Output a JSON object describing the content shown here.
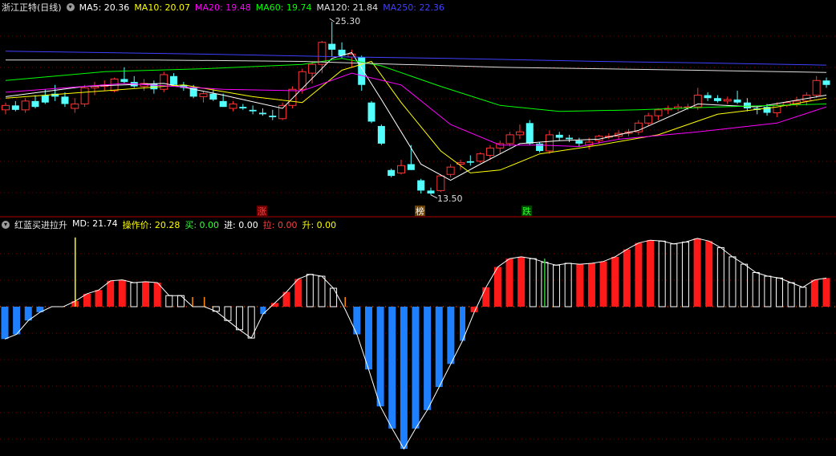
{
  "top_panel": {
    "title": "浙江正特(日线)",
    "ma_legend": [
      {
        "label": "MA5: 20.36",
        "color": "#ffffff"
      },
      {
        "label": "MA10: 20.07",
        "color": "#ffff00"
      },
      {
        "label": "MA20: 19.48",
        "color": "#ff00ff"
      },
      {
        "label": "MA60: 19.74",
        "color": "#00ff00"
      },
      {
        "label": "MA120: 21.84",
        "color": "#e0e0e0"
      },
      {
        "label": "MA250: 22.36",
        "color": "#4040ff"
      }
    ],
    "high_label": "25.30",
    "low_label": "13.50",
    "markers": [
      {
        "text": "涨",
        "color": "#ff4040",
        "bg": "#6a0000"
      },
      {
        "text": "榜",
        "color": "#ffffff",
        "bg": "#6a4000"
      },
      {
        "text": "跌",
        "color": "#33ff33",
        "bg": "#004400"
      }
    ]
  },
  "bottom_panel": {
    "title": "红蓝买进拉升",
    "legend": [
      {
        "label": "MD: 21.74",
        "color": "#ffffff"
      },
      {
        "label": "操作价: 20.28",
        "color": "#ffff00"
      },
      {
        "label": "买: 0.00",
        "color": "#33ff33"
      },
      {
        "label": "进: 0.00",
        "color": "#ffffff"
      },
      {
        "label": "拉: 0.00",
        "color": "#ff4040"
      },
      {
        "label": "升: 0.00",
        "color": "#ffff00"
      }
    ]
  },
  "chart_data": [
    {
      "type": "candlestick",
      "title": "浙江正特(日线)",
      "candles_ohlc": [
        [
          19.3,
          19.8,
          19.0,
          19.6
        ],
        [
          19.6,
          19.9,
          19.2,
          19.3
        ],
        [
          19.3,
          20.1,
          19.1,
          19.9
        ],
        [
          19.9,
          20.3,
          19.4,
          19.5
        ],
        [
          20.3,
          20.7,
          19.7,
          19.8
        ],
        [
          20.4,
          21.0,
          19.9,
          20.2
        ],
        [
          20.2,
          20.5,
          19.5,
          19.7
        ],
        [
          19.4,
          20.1,
          19.1,
          19.7
        ],
        [
          19.7,
          21.0,
          19.5,
          20.8
        ],
        [
          20.8,
          21.2,
          20.3,
          20.9
        ],
        [
          20.9,
          21.3,
          20.6,
          21.0
        ],
        [
          20.6,
          21.5,
          20.5,
          21.4
        ],
        [
          21.4,
          22.2,
          21.1,
          21.2
        ],
        [
          21.2,
          21.6,
          20.8,
          20.9
        ],
        [
          20.9,
          21.4,
          20.6,
          21.1
        ],
        [
          21.1,
          21.3,
          20.4,
          20.7
        ],
        [
          20.7,
          21.9,
          20.5,
          21.7
        ],
        [
          21.6,
          21.8,
          20.9,
          21.0
        ],
        [
          21.0,
          21.2,
          20.6,
          20.8
        ],
        [
          20.8,
          21.0,
          20.1,
          20.2
        ],
        [
          20.2,
          20.6,
          19.8,
          20.4
        ],
        [
          20.4,
          20.7,
          19.9,
          20.0
        ],
        [
          19.9,
          20.4,
          19.5,
          19.5
        ],
        [
          19.4,
          19.9,
          19.2,
          19.7
        ],
        [
          19.5,
          19.7,
          19.3,
          19.4
        ],
        [
          19.3,
          19.6,
          19.0,
          19.2
        ],
        [
          19.1,
          19.4,
          18.9,
          19.0
        ],
        [
          18.9,
          19.3,
          18.6,
          18.8
        ],
        [
          18.7,
          19.8,
          18.6,
          19.6
        ],
        [
          19.6,
          20.9,
          19.4,
          20.7
        ],
        [
          20.7,
          22.1,
          20.4,
          21.9
        ],
        [
          21.8,
          22.6,
          21.1,
          22.4
        ],
        [
          22.4,
          24.0,
          21.8,
          23.9
        ],
        [
          23.8,
          25.3,
          22.9,
          23.4
        ],
        [
          23.4,
          23.9,
          22.8,
          23.0
        ],
        [
          22.9,
          23.4,
          22.2,
          23.1
        ],
        [
          22.9,
          23.0,
          20.6,
          21.0
        ],
        [
          19.8,
          19.9,
          18.4,
          18.5
        ],
        [
          18.2,
          18.3,
          16.9,
          17.0
        ],
        [
          15.2,
          15.3,
          14.7,
          14.8
        ],
        [
          15.0,
          15.9,
          14.9,
          15.5
        ],
        [
          15.6,
          16.9,
          15.2,
          15.2
        ],
        [
          14.5,
          14.6,
          13.6,
          13.8
        ],
        [
          13.8,
          14.0,
          13.5,
          13.6
        ],
        [
          13.8,
          14.9,
          13.7,
          14.8
        ],
        [
          14.9,
          15.6,
          14.7,
          15.4
        ],
        [
          15.6,
          15.9,
          15.2,
          15.7
        ],
        [
          15.8,
          16.2,
          15.5,
          15.7
        ],
        [
          15.8,
          16.4,
          15.7,
          16.3
        ],
        [
          16.2,
          16.9,
          15.9,
          16.7
        ],
        [
          16.7,
          17.2,
          16.3,
          17.0
        ],
        [
          17.0,
          17.8,
          16.8,
          17.6
        ],
        [
          17.6,
          18.3,
          17.3,
          17.8
        ],
        [
          18.4,
          18.6,
          16.9,
          17.0
        ],
        [
          17.0,
          17.1,
          16.4,
          16.5
        ],
        [
          16.5,
          17.9,
          16.3,
          17.6
        ],
        [
          17.6,
          17.8,
          17.2,
          17.4
        ],
        [
          17.4,
          17.6,
          17.1,
          17.3
        ],
        [
          17.2,
          17.4,
          16.8,
          17.0
        ],
        [
          16.9,
          17.4,
          16.6,
          17.1
        ],
        [
          17.2,
          17.6,
          17.0,
          17.5
        ],
        [
          17.5,
          17.7,
          17.3,
          17.5
        ],
        [
          17.5,
          17.9,
          17.3,
          17.7
        ],
        [
          17.7,
          18.0,
          17.5,
          17.8
        ],
        [
          17.8,
          18.6,
          17.6,
          18.4
        ],
        [
          18.4,
          19.1,
          18.2,
          18.9
        ],
        [
          18.9,
          19.4,
          18.6,
          19.3
        ],
        [
          19.3,
          19.6,
          19.0,
          19.4
        ],
        [
          19.4,
          19.7,
          19.2,
          19.5
        ],
        [
          19.5,
          19.7,
          19.3,
          19.5
        ],
        [
          19.5,
          20.8,
          19.3,
          20.3
        ],
        [
          20.3,
          20.5,
          19.9,
          20.1
        ],
        [
          20.1,
          20.3,
          19.8,
          19.9
        ],
        [
          19.9,
          20.2,
          19.7,
          20.0
        ],
        [
          20.0,
          20.6,
          19.7,
          19.8
        ],
        [
          19.8,
          20.1,
          19.2,
          19.4
        ],
        [
          19.4,
          19.6,
          19.0,
          19.3
        ],
        [
          19.5,
          19.7,
          18.9,
          19.1
        ],
        [
          19.1,
          19.8,
          18.8,
          19.6
        ],
        [
          19.6,
          19.9,
          19.5,
          19.8
        ],
        [
          19.7,
          20.2,
          19.5,
          19.9
        ],
        [
          19.9,
          20.5,
          19.6,
          20.3
        ],
        [
          20.3,
          21.6,
          20.1,
          21.3
        ],
        [
          21.3,
          21.5,
          20.8,
          21.0
        ]
      ],
      "y_range": [
        13.0,
        25.8
      ],
      "annotations": {
        "high": "25.30",
        "low": "13.50"
      },
      "series": [
        {
          "name": "MA5",
          "color": "#ffffff",
          "points": [
            [
              0,
              20.2
            ],
            [
              8,
              20.9
            ],
            [
              16,
              21.1
            ],
            [
              22,
              20.3
            ],
            [
              28,
              19.4
            ],
            [
              33,
              22.8
            ],
            [
              35,
              23.2
            ],
            [
              38,
              20.0
            ],
            [
              42,
              15.6
            ],
            [
              45,
              14.5
            ],
            [
              48,
              15.6
            ],
            [
              52,
              17.0
            ],
            [
              56,
              17.2
            ],
            [
              60,
              17.3
            ],
            [
              64,
              17.9
            ],
            [
              70,
              19.7
            ],
            [
              76,
              19.5
            ],
            [
              83,
              20.3
            ]
          ]
        },
        {
          "name": "MA10",
          "color": "#ffff00",
          "points": [
            [
              0,
              20.1
            ],
            [
              10,
              20.6
            ],
            [
              18,
              21.0
            ],
            [
              25,
              20.2
            ],
            [
              30,
              19.8
            ],
            [
              34,
              22.0
            ],
            [
              37,
              22.6
            ],
            [
              40,
              19.8
            ],
            [
              44,
              16.5
            ],
            [
              47,
              15.0
            ],
            [
              50,
              15.2
            ],
            [
              54,
              16.3
            ],
            [
              60,
              16.9
            ],
            [
              66,
              17.6
            ],
            [
              72,
              19.0
            ],
            [
              78,
              19.5
            ],
            [
              83,
              20.1
            ]
          ]
        },
        {
          "name": "MA20",
          "color": "#ff00ff",
          "points": [
            [
              0,
              20.5
            ],
            [
              12,
              21.1
            ],
            [
              22,
              20.7
            ],
            [
              30,
              20.6
            ],
            [
              35,
              21.8
            ],
            [
              40,
              21.0
            ],
            [
              45,
              18.3
            ],
            [
              50,
              16.9
            ],
            [
              54,
              16.9
            ],
            [
              58,
              16.8
            ],
            [
              62,
              17.3
            ],
            [
              70,
              17.8
            ],
            [
              78,
              18.4
            ],
            [
              83,
              19.5
            ]
          ]
        },
        {
          "name": "MA60",
          "color": "#00ff00",
          "points": [
            [
              0,
              21.3
            ],
            [
              10,
              21.9
            ],
            [
              20,
              22.1
            ],
            [
              30,
              22.4
            ],
            [
              34,
              22.8
            ],
            [
              38,
              22.3
            ],
            [
              44,
              20.9
            ],
            [
              50,
              19.6
            ],
            [
              56,
              19.2
            ],
            [
              64,
              19.3
            ],
            [
              72,
              19.5
            ],
            [
              83,
              19.7
            ]
          ]
        },
        {
          "name": "MA120",
          "color": "#e0e0e0",
          "points": [
            [
              0,
              22.7
            ],
            [
              15,
              22.7
            ],
            [
              30,
              22.6
            ],
            [
              40,
              22.4
            ],
            [
              50,
              22.2
            ],
            [
              60,
              22.1
            ],
            [
              70,
              22.0
            ],
            [
              83,
              21.85
            ]
          ]
        },
        {
          "name": "MA250",
          "color": "#4040ff",
          "points": [
            [
              0,
              23.3
            ],
            [
              20,
              23.1
            ],
            [
              35,
              22.9
            ],
            [
              45,
              22.8
            ],
            [
              60,
              22.6
            ],
            [
              70,
              22.5
            ],
            [
              83,
              22.35
            ]
          ]
        }
      ]
    },
    {
      "type": "bar",
      "title": "红蓝买进拉升",
      "y_range": [
        -16,
        8
      ],
      "bars": [
        -3.5,
        -3.0,
        -1.5,
        -0.6,
        0,
        0,
        0.6,
        1.4,
        1.8,
        2.8,
        2.9,
        2.6,
        2.7,
        2.6,
        1.2,
        1.2,
        0,
        0,
        -0.5,
        -1.5,
        -2.5,
        -3.4,
        -0.8,
        0.4,
        1.6,
        3.0,
        3.5,
        3.3,
        2.0,
        -0.3,
        -3.0,
        -6.8,
        -10.8,
        -13.2,
        -15.4,
        -13.2,
        -11.2,
        -8.7,
        -6.2,
        -3.7,
        -0.6,
        2.1,
        4.3,
        5.2,
        5.4,
        5.2,
        4.8,
        4.5,
        4.7,
        4.6,
        4.7,
        4.9,
        5.4,
        6.2,
        6.9,
        7.2,
        7.1,
        6.8,
        7.0,
        7.4,
        7.1,
        6.4,
        5.4,
        4.6,
        3.7,
        3.3,
        3.1,
        2.6,
        2.1,
        2.9,
        3.1
      ],
      "bar_colors": [
        "b",
        "b",
        "b",
        "b",
        "w",
        "w",
        "r",
        "r",
        "r",
        "r",
        "r",
        "w",
        "r",
        "r",
        "w",
        "w",
        "o",
        "o",
        "w",
        "w",
        "w",
        "w",
        "bs",
        "r",
        "r",
        "r",
        "w",
        "w",
        "w",
        "o",
        "b",
        "b",
        "b",
        "b",
        "b",
        "b",
        "b",
        "b",
        "b",
        "bs",
        "r",
        "r",
        "r",
        "r",
        "r",
        "w",
        "w",
        "w",
        "w",
        "r",
        "r",
        "r",
        "r",
        "r",
        "r",
        "r",
        "w",
        "w",
        "w",
        "r",
        "r",
        "w",
        "w",
        "w",
        "w",
        "w",
        "w",
        "w",
        "w",
        "r",
        "r"
      ],
      "signal_lines": [
        {
          "index": 6,
          "height": 7.5,
          "color": "#ffff00"
        },
        {
          "index": 46,
          "height": 5.2,
          "color": "#33cc33"
        }
      ]
    }
  ]
}
